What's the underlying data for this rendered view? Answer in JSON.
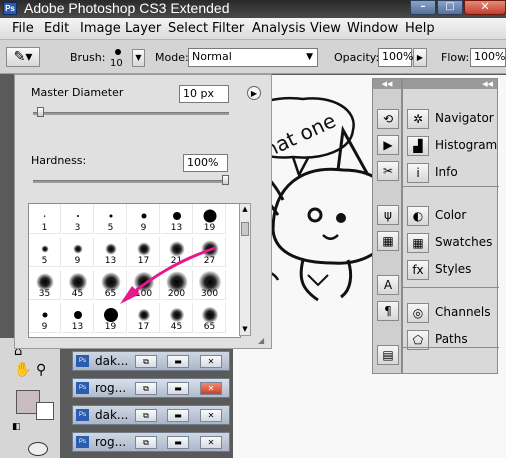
{
  "window": {
    "title": "Adobe Photoshop CS3 Extended",
    "logo": "Ps",
    "min_label": "–",
    "max_label": "□",
    "close_label": "✕"
  },
  "menu": [
    "File",
    "Edit",
    "Image",
    "Layer",
    "Select",
    "Filter",
    "Analysis",
    "View",
    "Window",
    "Help"
  ],
  "options": {
    "brush_label": "Brush:",
    "brush_size": "10",
    "mode_label": "Mode:",
    "mode_value": "Normal",
    "opacity_label": "Opacity:",
    "opacity_value": "100%",
    "flow_label": "Flow:",
    "flow_value": "100%"
  },
  "brush_picker": {
    "master_label": "Master Diameter",
    "master_value": "10 px",
    "hardness_label": "Hardness:",
    "hardness_value": "100%",
    "master_slider": 0.02,
    "hardness_slider": 1.0,
    "rows": [
      [
        {
          "label": "1",
          "size": 1.5,
          "soft": false
        },
        {
          "label": "3",
          "size": 2,
          "soft": false
        },
        {
          "label": "5",
          "size": 3,
          "soft": false
        },
        {
          "label": "9",
          "size": 5,
          "soft": false
        },
        {
          "label": "13",
          "size": 8,
          "soft": false
        },
        {
          "label": "19",
          "size": 13,
          "soft": false
        }
      ],
      [
        {
          "label": "5",
          "size": 3,
          "soft": true
        },
        {
          "label": "9",
          "size": 5,
          "soft": true
        },
        {
          "label": "13",
          "size": 7,
          "soft": true
        },
        {
          "label": "17",
          "size": 9,
          "soft": true
        },
        {
          "label": "21",
          "size": 11,
          "soft": true
        },
        {
          "label": "27",
          "size": 13,
          "soft": true
        }
      ],
      [
        {
          "label": "35",
          "size": 13,
          "soft": true
        },
        {
          "label": "45",
          "size": 14,
          "soft": true
        },
        {
          "label": "65",
          "size": 15,
          "soft": true
        },
        {
          "label": "100",
          "size": 16,
          "soft": true
        },
        {
          "label": "200",
          "size": 17,
          "soft": true
        },
        {
          "label": "300",
          "size": 18,
          "soft": true
        }
      ],
      [
        {
          "label": "9",
          "size": 5,
          "soft": false
        },
        {
          "label": "13",
          "size": 8,
          "soft": false
        },
        {
          "label": "19",
          "size": 14,
          "soft": false
        },
        {
          "label": "17",
          "size": 8,
          "soft": true
        },
        {
          "label": "45",
          "size": 10,
          "soft": true
        },
        {
          "label": "65",
          "size": 12,
          "soft": true
        }
      ]
    ]
  },
  "doc_tabs": [
    {
      "name": "dak...",
      "active": false
    },
    {
      "name": "rog...",
      "active": true
    },
    {
      "name": "dak...",
      "active": false
    },
    {
      "name": "rog...",
      "active": false
    }
  ],
  "panels": [
    {
      "label": "Navigator",
      "icon": "navigator-icon",
      "glyph": "✲"
    },
    {
      "label": "Histogram",
      "icon": "histogram-icon",
      "glyph": "▟"
    },
    {
      "label": "Info",
      "icon": "info-icon",
      "glyph": "i"
    },
    {
      "label": "Color",
      "icon": "color-icon",
      "glyph": "◐"
    },
    {
      "label": "Swatches",
      "icon": "swatches-icon",
      "glyph": "▦"
    },
    {
      "label": "Styles",
      "icon": "styles-icon",
      "glyph": "fx"
    },
    {
      "label": "Channels",
      "icon": "channels-icon",
      "glyph": "◎"
    },
    {
      "label": "Paths",
      "icon": "paths-icon",
      "glyph": "⬠"
    }
  ],
  "canvas_text": "that one",
  "colors": {
    "accent": "#e8178a",
    "title_bar": "#2a2a2a",
    "menu_bg": "#e8e8e8"
  }
}
